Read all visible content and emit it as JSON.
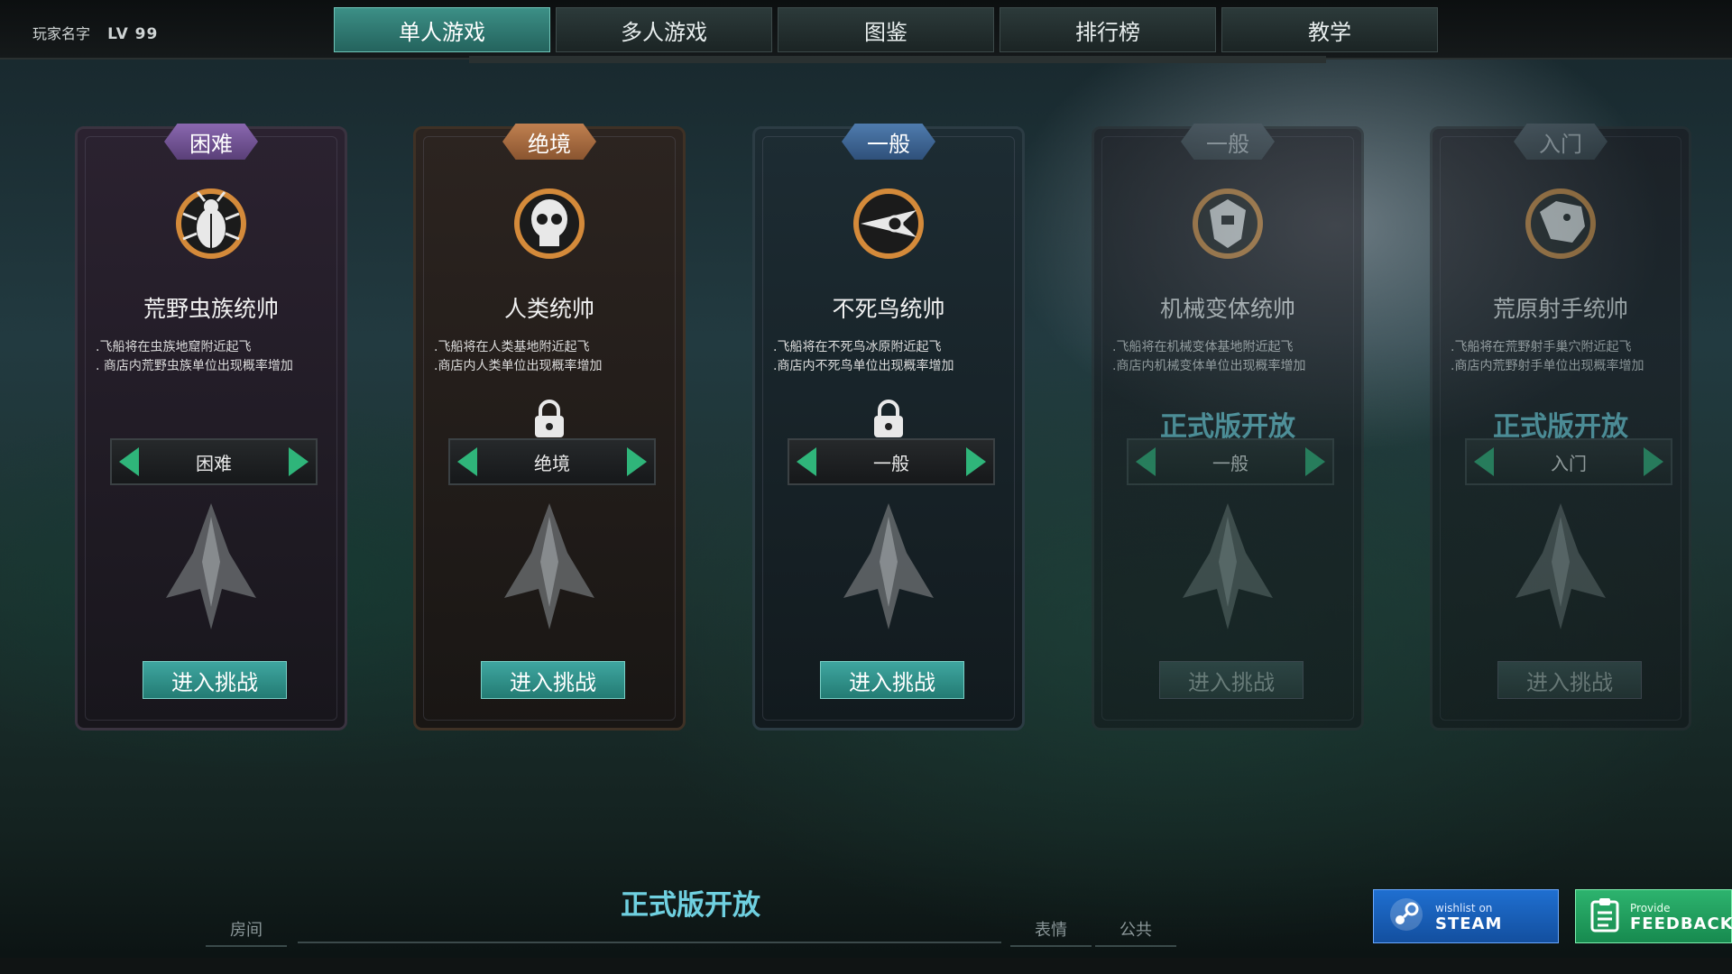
{
  "player": {
    "name_label": "玩家名字",
    "level": "LV 99"
  },
  "tabs": [
    {
      "label": "单人游戏",
      "active": true
    },
    {
      "label": "多人游戏"
    },
    {
      "label": "图鉴"
    },
    {
      "label": "排行榜"
    },
    {
      "label": "教学"
    }
  ],
  "cards": [
    {
      "difficulty": "困难",
      "name": "荒野虫族统帅",
      "desc": [
        ".飞船将在虫族地窟附近起飞",
        ". 商店内荒野虫族单位出现概率增加"
      ],
      "selector": "困难",
      "button": "进入挑战",
      "theme": "purple",
      "locked": false,
      "padlock": false,
      "icon": "beetle-icon"
    },
    {
      "difficulty": "绝境",
      "name": "人类统帅",
      "desc": [
        ".飞船将在人类基地附近起飞",
        ".商店内人类单位出现概率增加"
      ],
      "selector": "绝境",
      "button": "进入挑战",
      "theme": "orange",
      "locked": false,
      "padlock": true,
      "icon": "skull-icon"
    },
    {
      "difficulty": "一般",
      "name": "不死鸟统帅",
      "desc": [
        ".飞船将在不死鸟冰原附近起飞",
        ".商店内不死鸟单位出现概率增加"
      ],
      "selector": "一般",
      "button": "进入挑战",
      "theme": "blue",
      "locked": false,
      "padlock": true,
      "icon": "phoenix-icon"
    },
    {
      "difficulty": "一般",
      "name": "机械变体统帅",
      "desc": [
        ".飞船将在机械变体基地附近起飞",
        ".商店内机械变体单位出现概率增加"
      ],
      "selector": "一般",
      "button": "进入挑战",
      "theme": "gray",
      "locked": true,
      "open_text": "正式版开放",
      "icon": "mech-icon"
    },
    {
      "difficulty": "入门",
      "name": "荒原射手统帅",
      "desc": [
        ".飞船将在荒野射手巢穴附近起飞",
        ".商店内荒野射手单位出现概率增加"
      ],
      "selector": "入门",
      "button": "进入挑战",
      "theme": "gray",
      "locked": true,
      "open_text": "正式版开放",
      "icon": "beast-icon"
    }
  ],
  "bottom": {
    "room": "房间",
    "open_text": "正式版开放",
    "emote": "表情",
    "public": "公共",
    "steam_small": "wishlist on",
    "steam_big": "STEAM",
    "feedback_small": "Provide",
    "feedback_big": "FEEDBACK"
  },
  "colors": {
    "accent": "#2fb57a",
    "open_text": "#6fd0e0",
    "steam": "#1f6fd0",
    "feedback": "#2db36e"
  }
}
